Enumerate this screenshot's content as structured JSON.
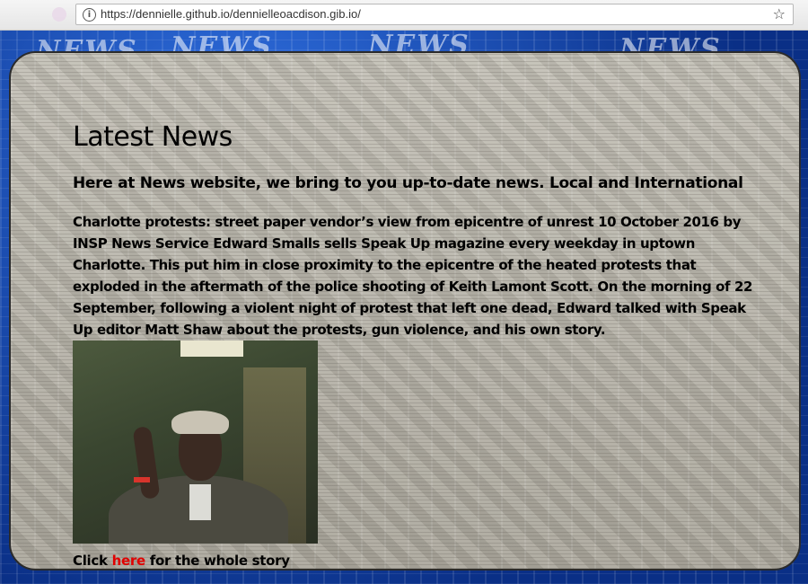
{
  "browser": {
    "url": "https://dennielle.github.io/dennielleoacdison.gib.io/",
    "info_glyph": "i",
    "star_glyph": "☆"
  },
  "background": {
    "words": [
      "NEWS",
      "NEWS",
      "NEWS",
      "NEWS"
    ]
  },
  "main": {
    "title": "Latest News",
    "intro": "Here at News website, we bring to you up-to-date news. Local and International",
    "article": "Charlotte protests: street paper vendor’s view from epicentre of unrest 10 October 2016 by INSP News Service Edward Smalls sells Speak Up magazine every weekday in uptown Charlotte. This put him in close proximity to the epicentre of the heated protests that exploded in the aftermath of the police shooting of Keith Lamont Scott. On the morning of 22 September, following a violent night of protest that left one dead, Edward talked with Speak Up editor Matt Shaw about the protests, gun violence, and his own story.",
    "cta_prefix": "Click ",
    "cta_link": "here",
    "cta_suffix": " for the whole story"
  },
  "colors": {
    "link": "#e00000",
    "page_background": "#0b3f9e"
  }
}
